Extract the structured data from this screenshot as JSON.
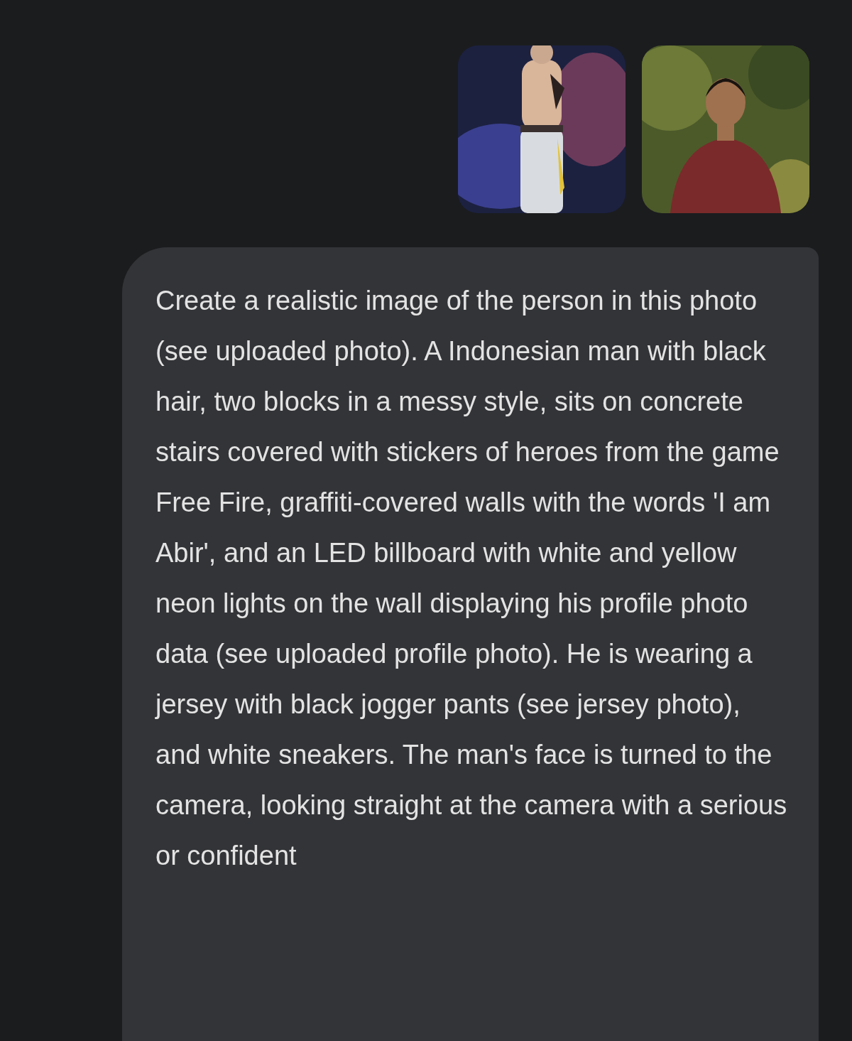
{
  "message": {
    "text": "Create a realistic image of the person in this photo (see uploaded photo). A Indonesian man with black hair, two blocks in a messy style, sits on concrete stairs covered with stickers of heroes from the game Free Fire, graffiti-covered walls with the words 'I am Abir', and an LED billboard with white and yellow neon lights on the wall displaying his profile photo data (see uploaded profile photo). He is wearing a jersey with black jogger pants (see jersey photo), and white sneakers. The man's face is turned to the camera, looking straight at the camera with a serious or confident"
  }
}
